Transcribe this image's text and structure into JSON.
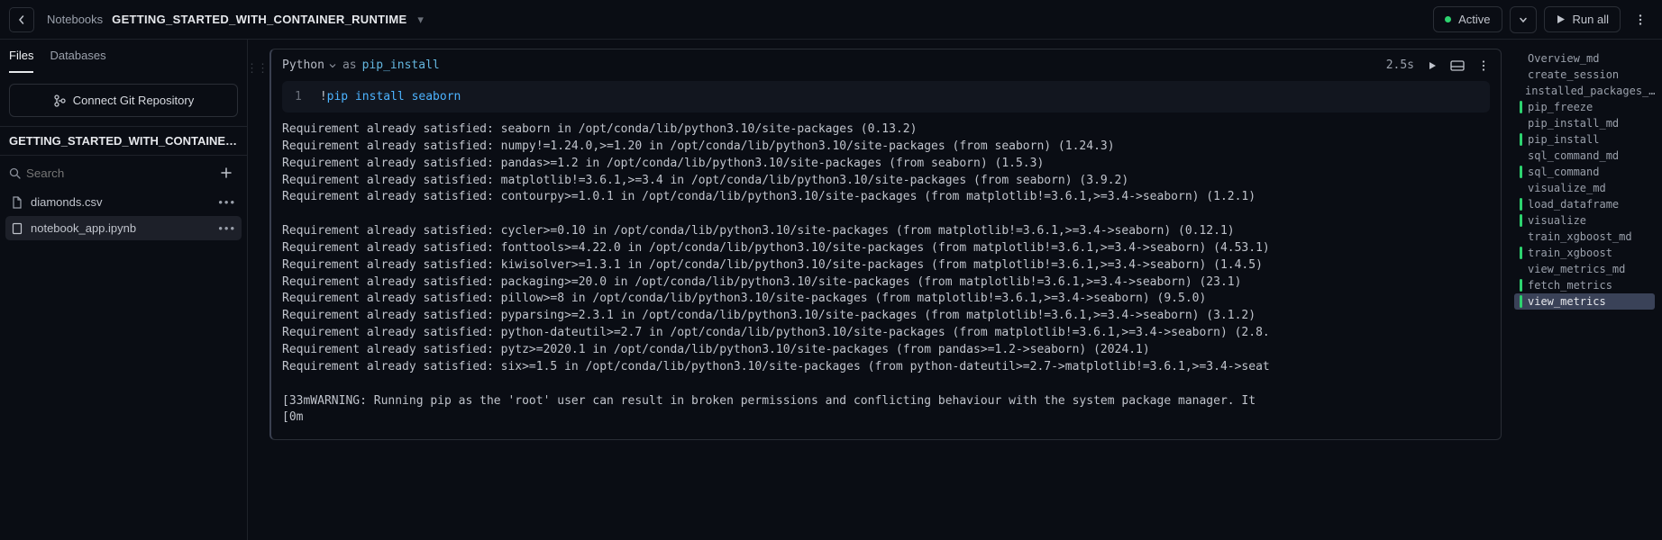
{
  "header": {
    "breadcrumb_label": "Notebooks",
    "title": "GETTING_STARTED_WITH_CONTAINER_RUNTIME",
    "status": "Active",
    "run_all_label": "Run all"
  },
  "sidebar": {
    "tabs": [
      "Files",
      "Databases"
    ],
    "active_tab": 0,
    "connect_label": "Connect Git Repository",
    "repo_name": "GETTING_STARTED_WITH_CONTAINER_RU...",
    "search_placeholder": "Search",
    "files": [
      {
        "name": "diamonds.csv",
        "icon": "file-icon",
        "selected": false
      },
      {
        "name": "notebook_app.ipynb",
        "icon": "notebook-icon",
        "selected": true
      }
    ]
  },
  "cell": {
    "language": "Python",
    "as_kw": "as",
    "name": "pip_install",
    "exec_time": "2.5s",
    "lineno": "1",
    "code_bang": "!",
    "code_cmd": "pip install",
    "code_arg": "seaborn",
    "output": "Requirement already satisfied: seaborn in /opt/conda/lib/python3.10/site-packages (0.13.2)\nRequirement already satisfied: numpy!=1.24.0,>=1.20 in /opt/conda/lib/python3.10/site-packages (from seaborn) (1.24.3)\nRequirement already satisfied: pandas>=1.2 in /opt/conda/lib/python3.10/site-packages (from seaborn) (1.5.3)\nRequirement already satisfied: matplotlib!=3.6.1,>=3.4 in /opt/conda/lib/python3.10/site-packages (from seaborn) (3.9.2)\nRequirement already satisfied: contourpy>=1.0.1 in /opt/conda/lib/python3.10/site-packages (from matplotlib!=3.6.1,>=3.4->seaborn) (1.2.1)\n\nRequirement already satisfied: cycler>=0.10 in /opt/conda/lib/python3.10/site-packages (from matplotlib!=3.6.1,>=3.4->seaborn) (0.12.1)\nRequirement already satisfied: fonttools>=4.22.0 in /opt/conda/lib/python3.10/site-packages (from matplotlib!=3.6.1,>=3.4->seaborn) (4.53.1)\nRequirement already satisfied: kiwisolver>=1.3.1 in /opt/conda/lib/python3.10/site-packages (from matplotlib!=3.6.1,>=3.4->seaborn) (1.4.5)\nRequirement already satisfied: packaging>=20.0 in /opt/conda/lib/python3.10/site-packages (from matplotlib!=3.6.1,>=3.4->seaborn) (23.1)\nRequirement already satisfied: pillow>=8 in /opt/conda/lib/python3.10/site-packages (from matplotlib!=3.6.1,>=3.4->seaborn) (9.5.0)\nRequirement already satisfied: pyparsing>=2.3.1 in /opt/conda/lib/python3.10/site-packages (from matplotlib!=3.6.1,>=3.4->seaborn) (3.1.2)\nRequirement already satisfied: python-dateutil>=2.7 in /opt/conda/lib/python3.10/site-packages (from matplotlib!=3.6.1,>=3.4->seaborn) (2.8.\nRequirement already satisfied: pytz>=2020.1 in /opt/conda/lib/python3.10/site-packages (from pandas>=1.2->seaborn) (2024.1)\nRequirement already satisfied: six>=1.5 in /opt/conda/lib/python3.10/site-packages (from python-dateutil>=2.7->matplotlib!=3.6.1,>=3.4->seat\n\n[33mWARNING: Running pip as the 'root' user can result in broken permissions and conflicting behaviour with the system package manager. It\n[0m"
  },
  "outline": [
    {
      "label": "Overview_md",
      "hl": false,
      "active": false
    },
    {
      "label": "create_session",
      "hl": false,
      "active": false
    },
    {
      "label": "installed_packages_…",
      "hl": false,
      "active": false
    },
    {
      "label": "pip_freeze",
      "hl": true,
      "active": false
    },
    {
      "label": "pip_install_md",
      "hl": false,
      "active": false
    },
    {
      "label": "pip_install",
      "hl": true,
      "active": false
    },
    {
      "label": "sql_command_md",
      "hl": false,
      "active": false
    },
    {
      "label": "sql_command",
      "hl": true,
      "active": false
    },
    {
      "label": "visualize_md",
      "hl": false,
      "active": false
    },
    {
      "label": "load_dataframe",
      "hl": true,
      "active": false
    },
    {
      "label": "visualize",
      "hl": true,
      "active": false
    },
    {
      "label": "train_xgboost_md",
      "hl": false,
      "active": false
    },
    {
      "label": "train_xgboost",
      "hl": true,
      "active": false
    },
    {
      "label": "view_metrics_md",
      "hl": false,
      "active": false
    },
    {
      "label": "fetch_metrics",
      "hl": true,
      "active": false
    },
    {
      "label": "view_metrics",
      "hl": true,
      "active": true
    }
  ]
}
